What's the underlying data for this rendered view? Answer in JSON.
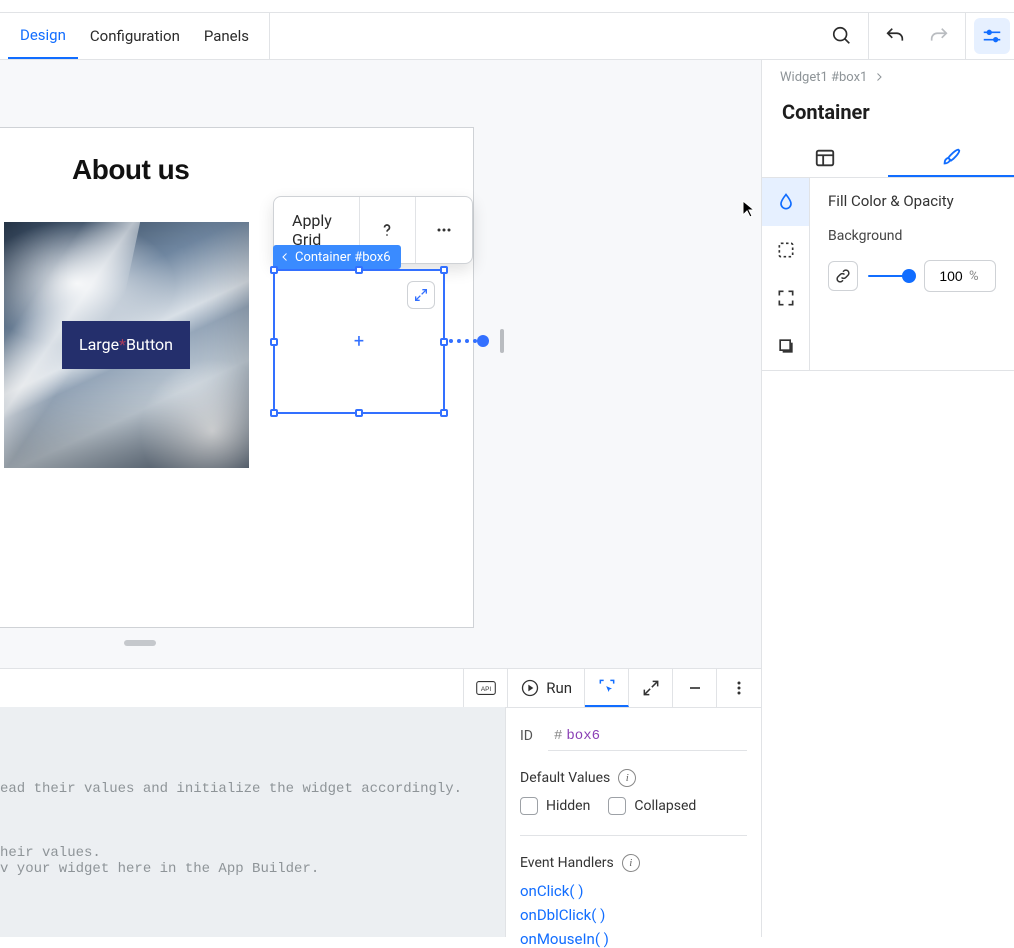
{
  "tabs": {
    "design": "Design",
    "config": "Configuration",
    "panels": "Panels"
  },
  "canvas": {
    "heading": "About us",
    "large_button": "Large*Button",
    "toolbar": {
      "apply_grid": "Apply Grid"
    },
    "selection_tag": "Container #box6"
  },
  "inspector": {
    "breadcrumb": "Widget1 #box1",
    "title": "Container",
    "fill_section": "Fill Color & Opacity",
    "background_label": "Background",
    "opacity_value": "100",
    "opacity_unit": "%"
  },
  "bottom": {
    "run": "Run",
    "api": "API",
    "code_lines": "\n\n\n\nead their values and initialize the widget accordingly.\n\n\n\nheir values.\nv your widget here in the App Builder.",
    "id_label": "ID",
    "id_hash": "#",
    "id_value": "box6",
    "defaults_header": "Default Values",
    "hidden": "Hidden",
    "collapsed": "Collapsed",
    "events_header": "Event Handlers",
    "handlers": {
      "click": "onClick( )",
      "dbl": "onDblClick( )",
      "mousein": "onMouseIn( )"
    }
  }
}
